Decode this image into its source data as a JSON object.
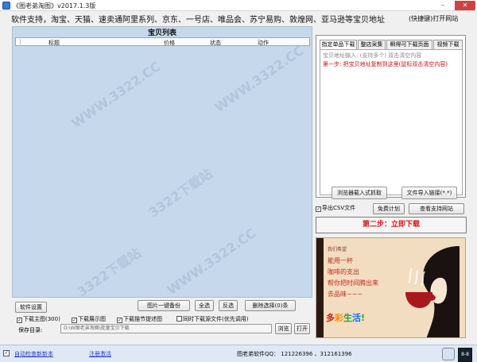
{
  "window": {
    "title": "《图老弟淘图》v2017.1.3版",
    "minimize_glyph": "–",
    "close_glyph": "✕"
  },
  "support": {
    "text": "软件支持，淘宝、天猫、速卖通阿里系列、京东、一号店、唯品会、苏宁易购、敦煌网、亚马逊等宝贝地址",
    "shortcut_link": "(快捷键)打开网站"
  },
  "product_list": {
    "title": "宝贝列表",
    "columns": [
      "",
      "标题",
      "价格",
      "状态",
      "动作"
    ]
  },
  "controls": {
    "settings_button": "软件设置",
    "backup_button": "图片一键备份",
    "select_all_button": "全选",
    "invert_button": "反选",
    "delete_button": "删除选择(0)条",
    "checkboxes": [
      {
        "label": "下载主图(300)",
        "checked": true
      },
      {
        "label": "下载展示图",
        "checked": true
      },
      {
        "label": "下载描节提述图",
        "checked": true
      },
      {
        "label": "同时下载源文件(优先调用)",
        "checked": false
      }
    ],
    "save_dir_label": "保存目录:",
    "save_dir_value": "D:\\W图老弟淘图\\批量宝贝下载",
    "browse_button": "浏览",
    "open_button": "打开"
  },
  "tabs": [
    {
      "label": "指定单品下载",
      "active": true
    },
    {
      "label": "整店采集",
      "active": false
    },
    {
      "label": "瞬得可下载页面",
      "active": false
    },
    {
      "label": "视频下载",
      "active": false
    }
  ],
  "tab_content": {
    "address_hint": "宝贝地址输入: (支持多个)  双击清空内容",
    "step1_text": "第一步: 把宝贝地址复制到这里(鼠标双击清空内容)",
    "browser_import_button": "浏览器载入式抓取",
    "file_import_button": "文件导入链接(*.*)"
  },
  "options": {
    "export_csv_label": "导出CSV文件",
    "export_csv_checked": true,
    "free_plan_button": "免费计划",
    "view_sites_button": "查看支持网站",
    "step2_button": "第二步：立即下载"
  },
  "ad": {
    "lines": [
      "我们希望",
      "能用一杯",
      "咖啡的支出",
      "帮你把时间腾出来",
      "去品味~~~"
    ],
    "slogan_chars": [
      "多",
      "彩",
      "生",
      "活",
      "!"
    ],
    "slogan_colors": [
      "#d11a1a",
      "#ff8c00",
      "#15a83a",
      "#1e6fe0",
      "#15a83a"
    ]
  },
  "statusbar": {
    "auto_check_label": "自动检查新新本",
    "auto_check_checked": true,
    "register_link": "注册激活",
    "qq_text": "图老弟软件QQ： 121226396 、312161396",
    "icon2_label": "8-8"
  },
  "watermark": {
    "text": "3322下载站",
    "url": "WWW.3322.CC"
  }
}
